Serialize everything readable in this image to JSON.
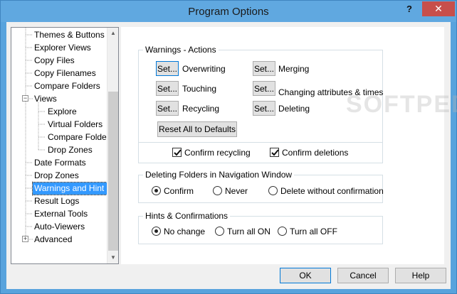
{
  "window": {
    "title": "Program Options",
    "help_label": "?",
    "close_label": "✕"
  },
  "tree": {
    "items": [
      {
        "label": "Themes & Buttons"
      },
      {
        "label": "Explorer Views"
      },
      {
        "label": "Copy Files"
      },
      {
        "label": "Copy Filenames"
      },
      {
        "label": "Compare Folders"
      },
      {
        "label": "Views"
      },
      {
        "label": "Explore"
      },
      {
        "label": "Virtual Folders"
      },
      {
        "label": "Compare Folde"
      },
      {
        "label": "Drop Zones"
      },
      {
        "label": "Date Formats"
      },
      {
        "label": "Drop Zones"
      },
      {
        "label": "Warnings and Hint"
      },
      {
        "label": "Result Logs"
      },
      {
        "label": "External Tools"
      },
      {
        "label": "Auto-Viewers"
      },
      {
        "label": "Advanced"
      }
    ],
    "expander_collapse": "−",
    "expander_expand": "+",
    "scroll_up": "▲",
    "scroll_down": "▼"
  },
  "warnings": {
    "legend": "Warnings - Actions",
    "set_label": "Set...",
    "overwriting": "Overwriting",
    "touching": "Touching",
    "recycling": "Recycling",
    "merging": "Merging",
    "changing": "Changing attributes & times",
    "deleting": "Deleting",
    "reset": "Reset All to Defaults",
    "confirm_recycling": "Confirm recycling",
    "confirm_deletions": "Confirm deletions"
  },
  "deleting": {
    "legend": "Deleting Folders in Navigation Window",
    "confirm": "Confirm",
    "never": "Never",
    "without": "Delete without confirmation"
  },
  "hints": {
    "legend": "Hints & Confirmations",
    "no_change": "No change",
    "turn_on": "Turn all ON",
    "turn_off": "Turn all OFF"
  },
  "footer": {
    "ok": "OK",
    "cancel": "Cancel",
    "help": "Help"
  }
}
